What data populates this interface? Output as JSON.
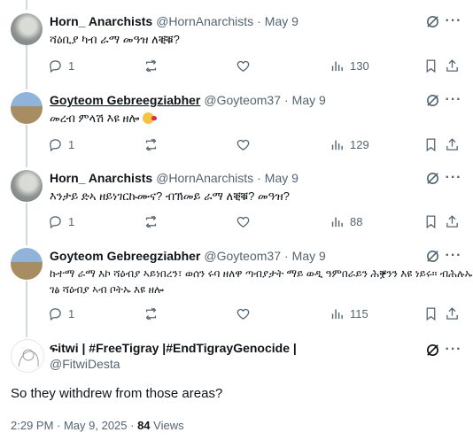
{
  "tweets": [
    {
      "name": "Horn_ Anarchists",
      "handle": "@HornAnarchists",
      "sep": "·",
      "date": "May 9",
      "text": "ሻዕቢያ ካብ ራማ መዓዝ ለቒቑ?",
      "replies": "1",
      "retweets": "",
      "likes": "",
      "views": "130",
      "avatar": "statue-icon"
    },
    {
      "name": "Goyteom Gebreegziabher",
      "handle": "@Goyteom37",
      "sep": "·",
      "date": "May 9",
      "text": "መረብ ምላሽ እዩ ዘሎ",
      "replies": "1",
      "retweets": "",
      "likes": "",
      "views": "129",
      "avatar": "person-icon"
    },
    {
      "name": "Horn_ Anarchists",
      "handle": "@HornAnarchists",
      "sep": "·",
      "date": "May 9",
      "text": "እንታይ ድኣ ዘይነገርኩሙና? ብኽመይ ራማ ለቒቑ? መዓዝ?",
      "replies": "1",
      "retweets": "",
      "likes": "",
      "views": "88",
      "avatar": "statue-icon"
    },
    {
      "name": "Goyteom Gebreegziabher",
      "handle": "@Goyteom37",
      "sep": "·",
      "date": "May 9",
      "text_line1": "ኩተማ ራማ እኮ ሻዕብያ ኣይነበረን፣ ወሰን ሩባ ዘለዋ ጣብያታት ማይ ወዲ ዓምበራይን ሕቛንን እዩ ነይሩ። ብሕሉኡ",
      "text_line2": "ገፅ ሻዕብያ ኣብ ቦትኡ እዩ ዘሎ",
      "replies": "1",
      "retweets": "",
      "likes": "",
      "views": "115",
      "avatar": "person-icon"
    }
  ],
  "main": {
    "name": "ፍitwi | #FreeTigray |#EndTigrayGenocide |",
    "handle": "@FitwiDesta",
    "text": "So they withdrew from those areas?",
    "time": "2:29 PM · May 9, 2025 · ",
    "views_count": "84",
    "views_label": "Views"
  },
  "icons": {
    "grok": "grok-icon",
    "more": "more-icon",
    "reply": "reply-icon",
    "retweet": "retweet-icon",
    "like": "heart-icon",
    "views": "views-icon",
    "bookmark": "bookmark-icon",
    "share": "share-icon"
  },
  "colors": {
    "text": "#0f1419",
    "secondary": "#536471",
    "thread_line": "#cfd9de",
    "divider": "#eff3f4"
  }
}
